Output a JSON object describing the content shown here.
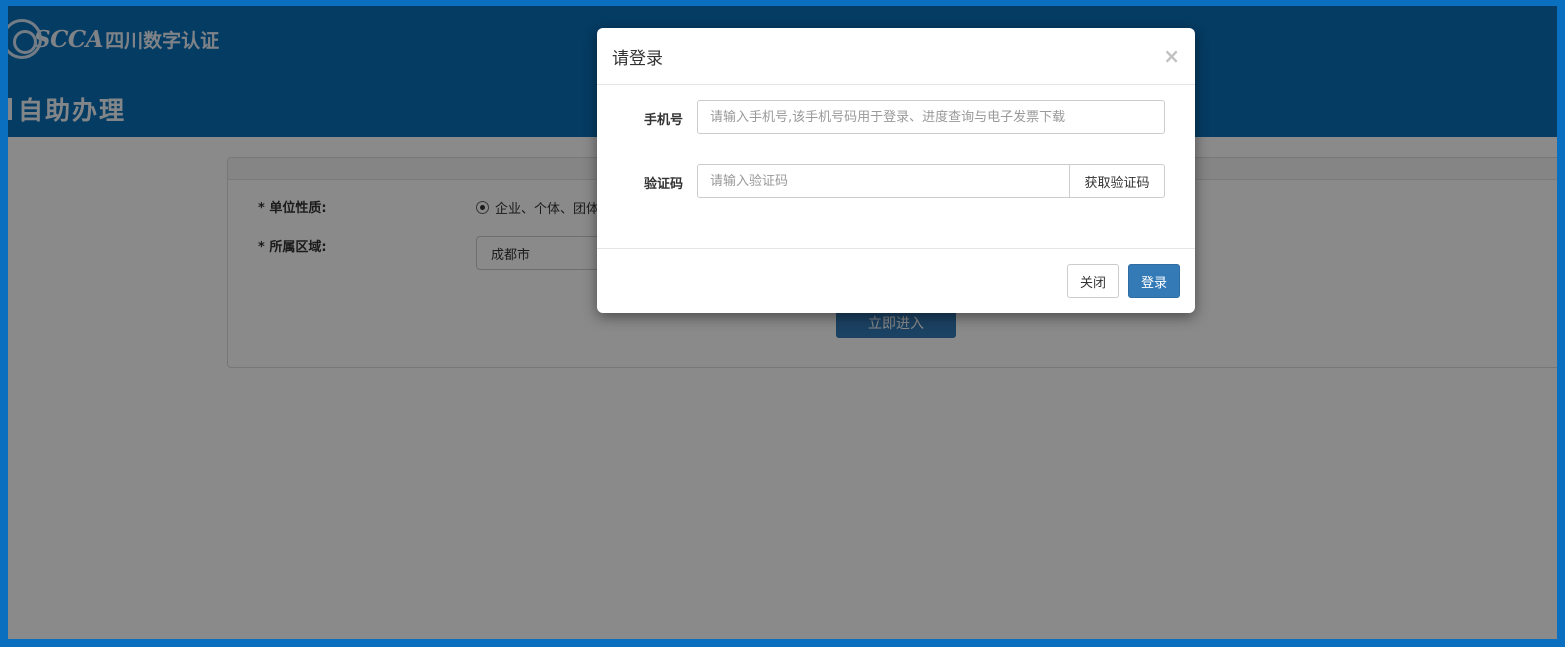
{
  "header": {
    "logo_text": "SCCA",
    "logo_sub": "四川数字认证",
    "page_title": "自助办理"
  },
  "form": {
    "unit_type_label": "* 单位性质:",
    "unit_type_option": "企业、个体、团体",
    "region_label": "* 所属区域:",
    "region_value": "成都市",
    "enter_button": "立即进入"
  },
  "modal": {
    "title": "请登录",
    "close_icon": "×",
    "phone_label": "手机号",
    "phone_placeholder": "请输入手机号,该手机号码用于登录、进度查询与电子发票下载",
    "code_label": "验证码",
    "code_placeholder": "请输入验证码",
    "get_code_button": "获取验证码",
    "close_button": "关闭",
    "login_button": "登录"
  },
  "colors": {
    "frame_border": "#0a6fbf",
    "banner": "#0a6fb8",
    "primary": "#337ab7"
  },
  "icons": {
    "logo": "scca-logo-icon",
    "close": "close-icon",
    "radio": "radio-selected-icon"
  }
}
